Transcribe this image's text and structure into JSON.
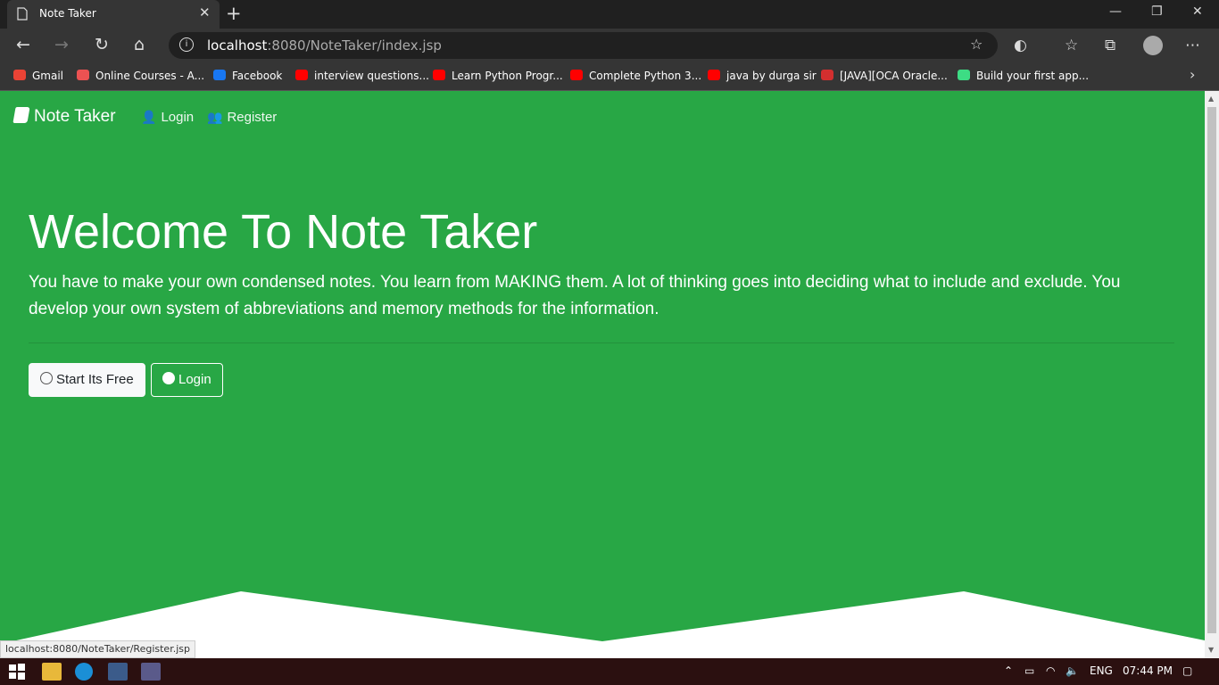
{
  "browser": {
    "tab_title": "Note Taker",
    "new_tab": "+",
    "url_host": "localhost",
    "url_rest": ":8080/NoteTaker/index.jsp",
    "status_url": "localhost:8080/NoteTaker/Register.jsp",
    "bookmarks": [
      {
        "label": "Gmail",
        "icon": "gmail-icon",
        "color": "#ea4335"
      },
      {
        "label": "Online Courses - A...",
        "icon": "udemy-icon",
        "color": "#ec5252"
      },
      {
        "label": "Facebook",
        "icon": "facebook-icon",
        "color": "#1877f2"
      },
      {
        "label": "interview questions...",
        "icon": "youtube-icon",
        "color": "#ff0000"
      },
      {
        "label": "Learn Python Progr...",
        "icon": "youtube-icon",
        "color": "#ff0000"
      },
      {
        "label": "Complete Python 3...",
        "icon": "youtube-icon",
        "color": "#ff0000"
      },
      {
        "label": "java by durga sir",
        "icon": "youtube-icon",
        "color": "#ff0000"
      },
      {
        "label": "[JAVA][OCA Oracle...",
        "icon": "pdf-icon",
        "color": "#d32f2f"
      },
      {
        "label": "Build your first app...",
        "icon": "android-icon",
        "color": "#3ddc84"
      }
    ]
  },
  "nav": {
    "brand": "Note Taker",
    "login": "Login",
    "register": "Register"
  },
  "hero": {
    "title": "Welcome To Note Taker",
    "lead": "You have to make your own condensed notes. You learn from MAKING them. A lot of thinking goes into deciding what to include and exclude. You develop your own system of abbreviations and memory methods for the information.",
    "start_button": "Start Its Free",
    "login_button": "Login"
  },
  "colors": {
    "primary_green": "#28a745"
  },
  "taskbar": {
    "lang": "ENG",
    "time": "07:44 PM"
  }
}
